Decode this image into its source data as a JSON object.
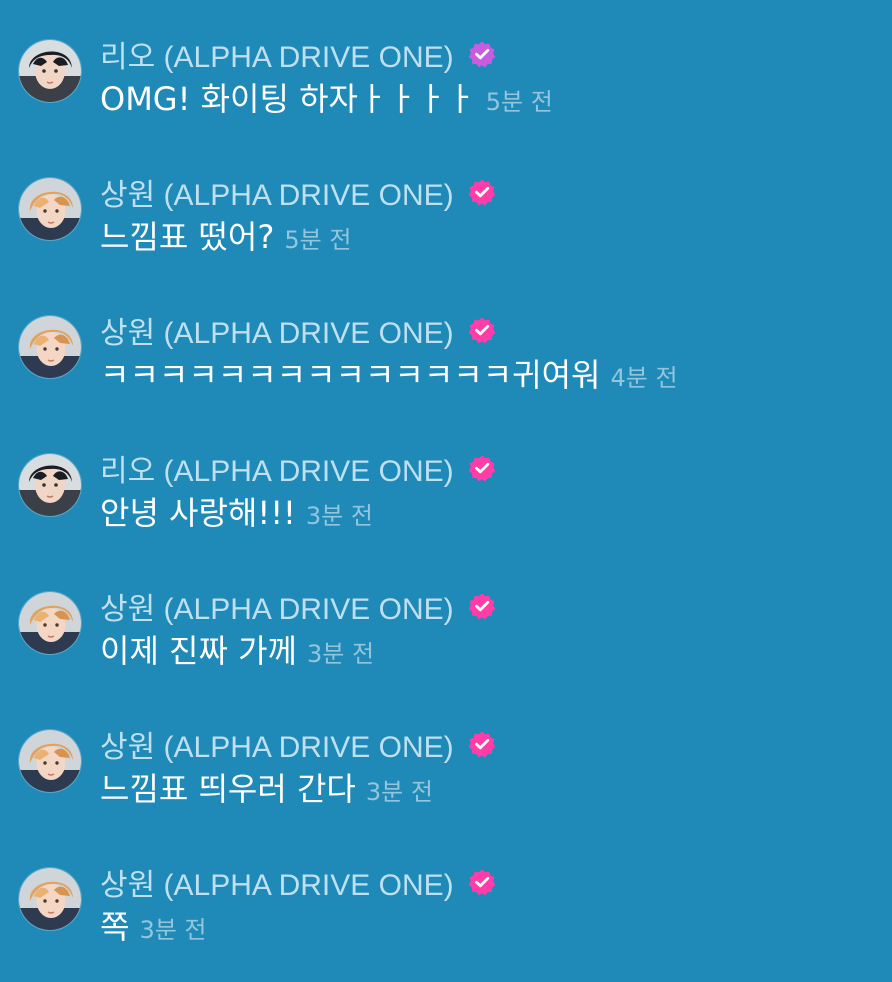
{
  "theme": {
    "background": "#1f89b7",
    "name_color": "#bfe0f0",
    "text_color": "#ffffff",
    "time_color": "#93c6dd",
    "verified_colors": [
      "#ff3ca8",
      "#c75ce0"
    ]
  },
  "messages": [
    {
      "author": "리오 (ALPHA DRIVE ONE)",
      "text": "OMG! 화이팅 하자ㅏㅏㅏㅏ",
      "time": "5분 전",
      "avatar": "avatar-rio",
      "badge": "verified-badge-icon"
    },
    {
      "author": "상원 (ALPHA DRIVE ONE)",
      "text": "느낌표 떴어?",
      "time": "5분 전",
      "avatar": "avatar-sangwon",
      "badge": "verified-badge-icon"
    },
    {
      "author": "상원 (ALPHA DRIVE ONE)",
      "text": "ㅋㅋㅋㅋㅋㅋㅋㅋㅋㅋㅋㅋㅋㅋ귀여워",
      "time": "4분 전",
      "avatar": "avatar-sangwon",
      "badge": "verified-badge-icon"
    },
    {
      "author": "리오 (ALPHA DRIVE ONE)",
      "text": "안녕 사랑해!!!",
      "time": "3분 전",
      "avatar": "avatar-rio",
      "badge": "verified-badge-icon"
    },
    {
      "author": "상원 (ALPHA DRIVE ONE)",
      "text": "이제 진짜 가께",
      "time": "3분 전",
      "avatar": "avatar-sangwon",
      "badge": "verified-badge-icon"
    },
    {
      "author": "상원 (ALPHA DRIVE ONE)",
      "text": "느낌표 띄우러 간다",
      "time": "3분 전",
      "avatar": "avatar-sangwon",
      "badge": "verified-badge-icon"
    },
    {
      "author": "상원 (ALPHA DRIVE ONE)",
      "text": "쪽",
      "time": "3분 전",
      "avatar": "avatar-sangwon",
      "badge": "verified-badge-icon"
    }
  ]
}
